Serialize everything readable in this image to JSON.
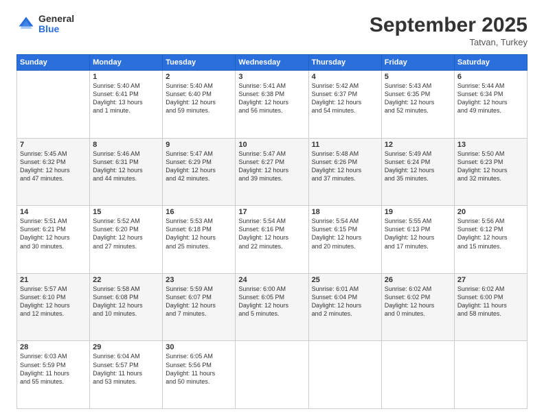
{
  "logo": {
    "general": "General",
    "blue": "Blue"
  },
  "header": {
    "month": "September 2025",
    "location": "Tatvan, Turkey"
  },
  "weekdays": [
    "Sunday",
    "Monday",
    "Tuesday",
    "Wednesday",
    "Thursday",
    "Friday",
    "Saturday"
  ],
  "weeks": [
    [
      {
        "day": "",
        "info": ""
      },
      {
        "day": "1",
        "info": "Sunrise: 5:40 AM\nSunset: 6:41 PM\nDaylight: 13 hours\nand 1 minute."
      },
      {
        "day": "2",
        "info": "Sunrise: 5:40 AM\nSunset: 6:40 PM\nDaylight: 12 hours\nand 59 minutes."
      },
      {
        "day": "3",
        "info": "Sunrise: 5:41 AM\nSunset: 6:38 PM\nDaylight: 12 hours\nand 56 minutes."
      },
      {
        "day": "4",
        "info": "Sunrise: 5:42 AM\nSunset: 6:37 PM\nDaylight: 12 hours\nand 54 minutes."
      },
      {
        "day": "5",
        "info": "Sunrise: 5:43 AM\nSunset: 6:35 PM\nDaylight: 12 hours\nand 52 minutes."
      },
      {
        "day": "6",
        "info": "Sunrise: 5:44 AM\nSunset: 6:34 PM\nDaylight: 12 hours\nand 49 minutes."
      }
    ],
    [
      {
        "day": "7",
        "info": "Sunrise: 5:45 AM\nSunset: 6:32 PM\nDaylight: 12 hours\nand 47 minutes."
      },
      {
        "day": "8",
        "info": "Sunrise: 5:46 AM\nSunset: 6:31 PM\nDaylight: 12 hours\nand 44 minutes."
      },
      {
        "day": "9",
        "info": "Sunrise: 5:47 AM\nSunset: 6:29 PM\nDaylight: 12 hours\nand 42 minutes."
      },
      {
        "day": "10",
        "info": "Sunrise: 5:47 AM\nSunset: 6:27 PM\nDaylight: 12 hours\nand 39 minutes."
      },
      {
        "day": "11",
        "info": "Sunrise: 5:48 AM\nSunset: 6:26 PM\nDaylight: 12 hours\nand 37 minutes."
      },
      {
        "day": "12",
        "info": "Sunrise: 5:49 AM\nSunset: 6:24 PM\nDaylight: 12 hours\nand 35 minutes."
      },
      {
        "day": "13",
        "info": "Sunrise: 5:50 AM\nSunset: 6:23 PM\nDaylight: 12 hours\nand 32 minutes."
      }
    ],
    [
      {
        "day": "14",
        "info": "Sunrise: 5:51 AM\nSunset: 6:21 PM\nDaylight: 12 hours\nand 30 minutes."
      },
      {
        "day": "15",
        "info": "Sunrise: 5:52 AM\nSunset: 6:20 PM\nDaylight: 12 hours\nand 27 minutes."
      },
      {
        "day": "16",
        "info": "Sunrise: 5:53 AM\nSunset: 6:18 PM\nDaylight: 12 hours\nand 25 minutes."
      },
      {
        "day": "17",
        "info": "Sunrise: 5:54 AM\nSunset: 6:16 PM\nDaylight: 12 hours\nand 22 minutes."
      },
      {
        "day": "18",
        "info": "Sunrise: 5:54 AM\nSunset: 6:15 PM\nDaylight: 12 hours\nand 20 minutes."
      },
      {
        "day": "19",
        "info": "Sunrise: 5:55 AM\nSunset: 6:13 PM\nDaylight: 12 hours\nand 17 minutes."
      },
      {
        "day": "20",
        "info": "Sunrise: 5:56 AM\nSunset: 6:12 PM\nDaylight: 12 hours\nand 15 minutes."
      }
    ],
    [
      {
        "day": "21",
        "info": "Sunrise: 5:57 AM\nSunset: 6:10 PM\nDaylight: 12 hours\nand 12 minutes."
      },
      {
        "day": "22",
        "info": "Sunrise: 5:58 AM\nSunset: 6:08 PM\nDaylight: 12 hours\nand 10 minutes."
      },
      {
        "day": "23",
        "info": "Sunrise: 5:59 AM\nSunset: 6:07 PM\nDaylight: 12 hours\nand 7 minutes."
      },
      {
        "day": "24",
        "info": "Sunrise: 6:00 AM\nSunset: 6:05 PM\nDaylight: 12 hours\nand 5 minutes."
      },
      {
        "day": "25",
        "info": "Sunrise: 6:01 AM\nSunset: 6:04 PM\nDaylight: 12 hours\nand 2 minutes."
      },
      {
        "day": "26",
        "info": "Sunrise: 6:02 AM\nSunset: 6:02 PM\nDaylight: 12 hours\nand 0 minutes."
      },
      {
        "day": "27",
        "info": "Sunrise: 6:02 AM\nSunset: 6:00 PM\nDaylight: 11 hours\nand 58 minutes."
      }
    ],
    [
      {
        "day": "28",
        "info": "Sunrise: 6:03 AM\nSunset: 5:59 PM\nDaylight: 11 hours\nand 55 minutes."
      },
      {
        "day": "29",
        "info": "Sunrise: 6:04 AM\nSunset: 5:57 PM\nDaylight: 11 hours\nand 53 minutes."
      },
      {
        "day": "30",
        "info": "Sunrise: 6:05 AM\nSunset: 5:56 PM\nDaylight: 11 hours\nand 50 minutes."
      },
      {
        "day": "",
        "info": ""
      },
      {
        "day": "",
        "info": ""
      },
      {
        "day": "",
        "info": ""
      },
      {
        "day": "",
        "info": ""
      }
    ]
  ]
}
